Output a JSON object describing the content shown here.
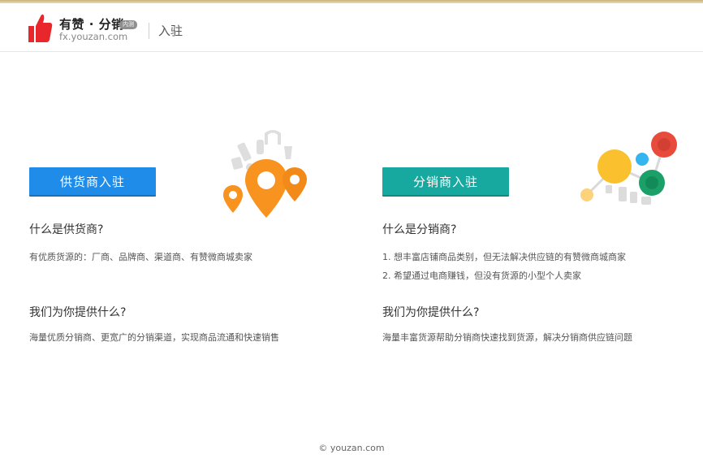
{
  "header": {
    "brand": "有赞 · 分销",
    "badge": "内测",
    "domain": "fx.youzan.com",
    "title": "入驻"
  },
  "supplier": {
    "button": "供货商入驻",
    "what_heading": "什么是供货商?",
    "what_text": "有优质货源的：厂商、品牌商、渠道商、有赞微商城卖家",
    "offer_heading": "我们为你提供什么?",
    "offer_text": "海量优质分销商、更宽广的分销渠道，实现商品流通和快速销售"
  },
  "distributor": {
    "button": "分销商入驻",
    "what_heading": "什么是分销商?",
    "what_items": [
      "1. 想丰富店铺商品类别，但无法解决供应链的有赞微商城商家",
      "2. 希望通过电商赚钱，但没有货源的小型个人卖家"
    ],
    "offer_heading": "我们为你提供什么?",
    "offer_text": "海量丰富货源帮助分销商快速找到货源，解决分销商供应链问题"
  },
  "footer": "© youzan.com",
  "colors": {
    "supplier_button": "#1e8ce8",
    "distributor_button": "#17a8a0",
    "logo_red": "#e8262b",
    "pin_orange": "#f7931e"
  },
  "icons": {
    "logo": "thumbs-up-icon",
    "supplier_illustration": "location-pins-illustration",
    "distributor_illustration": "network-nodes-illustration"
  }
}
